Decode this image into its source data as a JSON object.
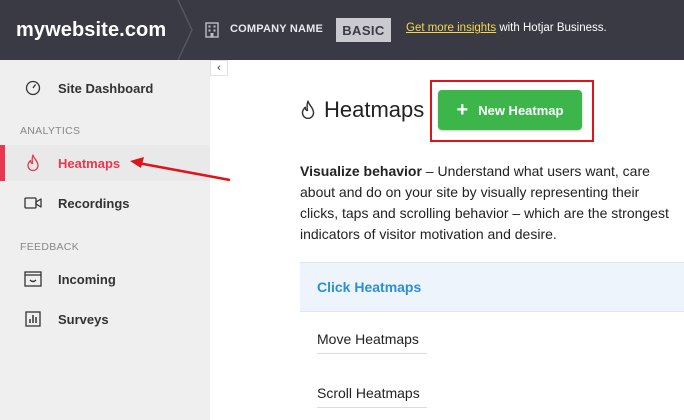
{
  "topbar": {
    "brand": "mywebsite.com",
    "company_name": "COMPANY NAME",
    "plan": "BASIC",
    "upsell_link": "Get more insights",
    "upsell_text": " with Hotjar Business.",
    "icons": [
      "building-icon",
      "chevron-right-icon"
    ]
  },
  "sidebar": {
    "collapse_label": "‹",
    "items": [
      {
        "label": "Site Dashboard",
        "icon": "gauge-icon"
      },
      {
        "label": "Heatmaps",
        "icon": "flame-icon",
        "active": true
      },
      {
        "label": "Recordings",
        "icon": "video-icon"
      },
      {
        "label": "Incoming",
        "icon": "inbox-icon"
      },
      {
        "label": "Surveys",
        "icon": "survey-icon"
      }
    ],
    "sections": {
      "analytics": "ANALYTICS",
      "feedback": "FEEDBACK"
    }
  },
  "main": {
    "title": "Heatmaps",
    "new_button": "New Heatmap",
    "description_bold": "Visualize behavior",
    "description_rest": " – Understand what users want, care about and do on your site by visually representing their clicks, taps and scrolling behavior – which are the strongest indicators of visitor motivation and desire.",
    "tabs": [
      "Click Heatmaps",
      "Move Heatmaps",
      "Scroll Heatmaps"
    ]
  },
  "colors": {
    "topbar": "#3a3a44",
    "accent_red": "#e8384f",
    "button_green": "#3cb54a",
    "link_yellow": "#f4d84a",
    "tab_blue": "#2b8fd6",
    "annotation_red": "#e0121a"
  }
}
